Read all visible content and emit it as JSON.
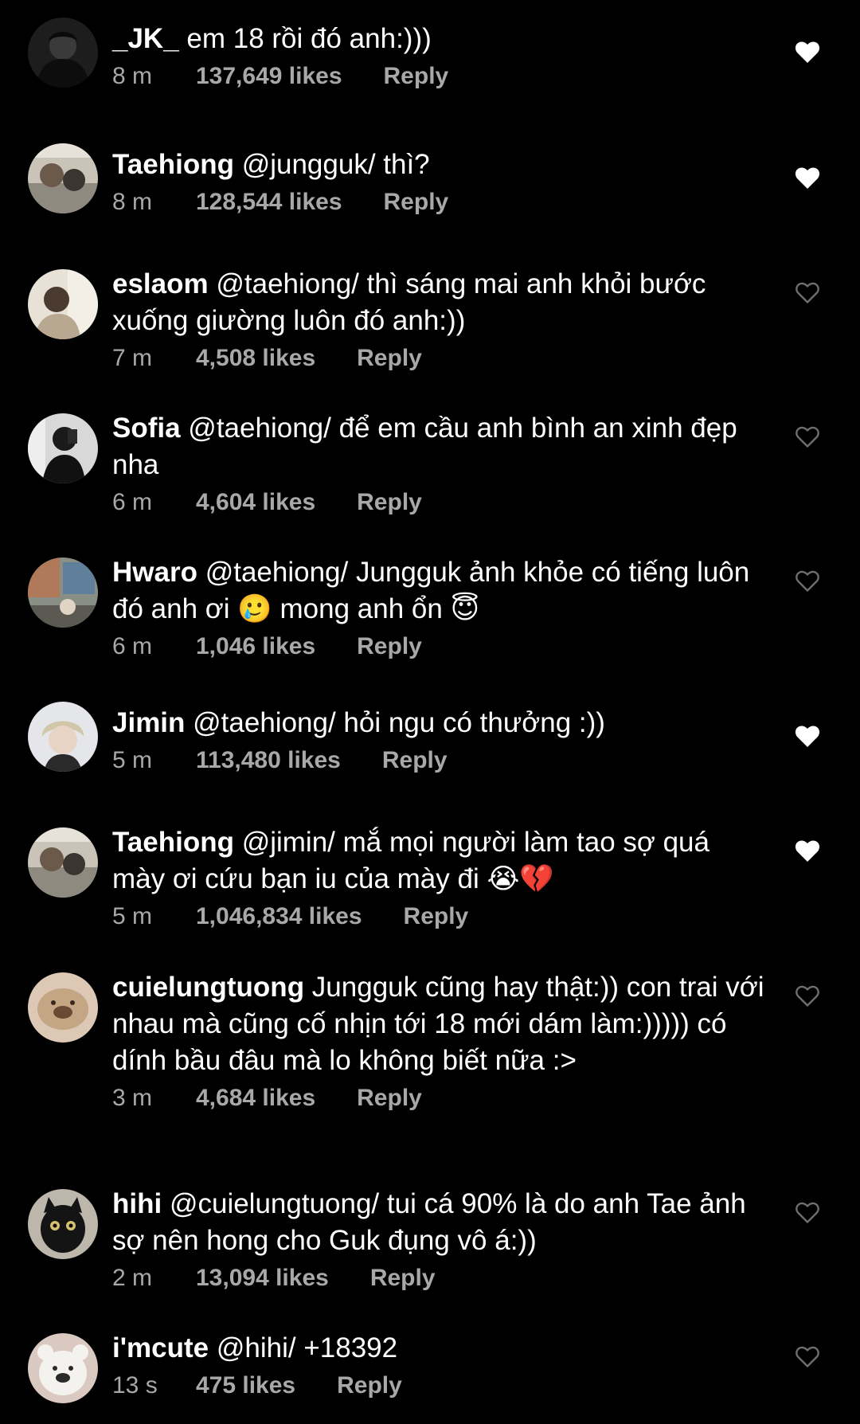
{
  "comments": [
    {
      "username": "_JK_",
      "text": " em 18 rồi đó anh:)))",
      "time": "8 m",
      "likes": "137,649 likes",
      "reply": "Reply",
      "liked": true,
      "avatar": "avatar-dark-hood"
    },
    {
      "username": "Taehiong",
      "text": " @jungguk/ thì?",
      "time": "8 m",
      "likes": "128,544 likes",
      "reply": "Reply",
      "liked": true,
      "avatar": "avatar-couple-photo"
    },
    {
      "username": "eslaom",
      "text": " @taehiong/ thì sáng mai anh khỏi bước xuống giường luôn đó anh:))",
      "time": "7 m",
      "likes": "4,508 likes",
      "reply": "Reply",
      "liked": false,
      "avatar": "avatar-boy-light"
    },
    {
      "username": "Sofia",
      "text": " @taehiong/ để em cầu anh bình an xinh đẹp nha",
      "time": "6 m",
      "likes": "4,604 likes",
      "reply": "Reply",
      "liked": false,
      "avatar": "avatar-girl-mirror"
    },
    {
      "username": "Hwaro",
      "text": " @taehiong/ Jungguk ảnh khỏe có tiếng luôn đó anh ơi 🥲 mong anh ổn 😇",
      "time": "6 m",
      "likes": "1,046 likes",
      "reply": "Reply",
      "liked": false,
      "avatar": "avatar-street"
    },
    {
      "username": "Jimin",
      "text": " @taehiong/ hỏi ngu có thưởng :))",
      "time": "5 m",
      "likes": "113,480 likes",
      "reply": "Reply",
      "liked": true,
      "avatar": "avatar-blond"
    },
    {
      "username": "Taehiong",
      "text": " @jimin/ mắ mọi người làm tao sợ quá mày ơi cứu bạn iu của mày đi 😭💔",
      "time": "5 m",
      "likes": "1,046,834 likes",
      "reply": "Reply",
      "liked": true,
      "avatar": "avatar-couple-photo"
    },
    {
      "username": "cuielungtuong",
      "text": " Jungguk cũng hay thật:)) con trai với nhau mà cũng cố nhịn tới 18 mới dám làm:))))) có dính bầu đâu mà lo không biết nữa :>",
      "time": "3 m",
      "likes": "4,684 likes",
      "reply": "Reply",
      "liked": false,
      "avatar": "avatar-bread"
    },
    {
      "username": "hihi",
      "text": " @cuielungtuong/ tui cá 90% là do anh Tae ảnh sợ nên hong cho Guk đụng vô á:))",
      "time": "2 m",
      "likes": "13,094 likes",
      "reply": "Reply",
      "liked": false,
      "avatar": "avatar-black-cat"
    },
    {
      "username": "i'mcute",
      "text": " @hihi/ +18392",
      "time": "13 s",
      "likes": "475 likes",
      "reply": "Reply",
      "liked": false,
      "avatar": "avatar-bear"
    }
  ],
  "colors": {
    "background": "#000000",
    "text": "#ffffff",
    "meta": "#a8a8a8",
    "heart_liked": "#ffffff",
    "heart_outline": "#6e6e6e"
  }
}
